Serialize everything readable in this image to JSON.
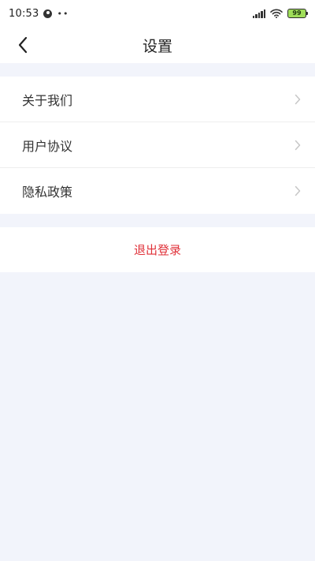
{
  "status_bar": {
    "time": "10:53",
    "dots": "••",
    "battery": "99",
    "icons": [
      "person-icon",
      "signal-icon",
      "wifi-icon",
      "battery-icon"
    ]
  },
  "nav": {
    "title": "设置",
    "back_icon": "chevron-left-icon"
  },
  "menu": {
    "items": [
      {
        "label": "关于我们",
        "icon": "chevron-right-icon"
      },
      {
        "label": "用户协议",
        "icon": "chevron-right-icon"
      },
      {
        "label": "隐私政策",
        "icon": "chevron-right-icon"
      }
    ]
  },
  "logout": {
    "label": "退出登录"
  },
  "colors": {
    "page_background": "#f2f4fb",
    "card_background": "#ffffff",
    "logout_text": "#e0323a",
    "battery_fill": "#a0de5a",
    "chevron": "#c7c7c7"
  }
}
